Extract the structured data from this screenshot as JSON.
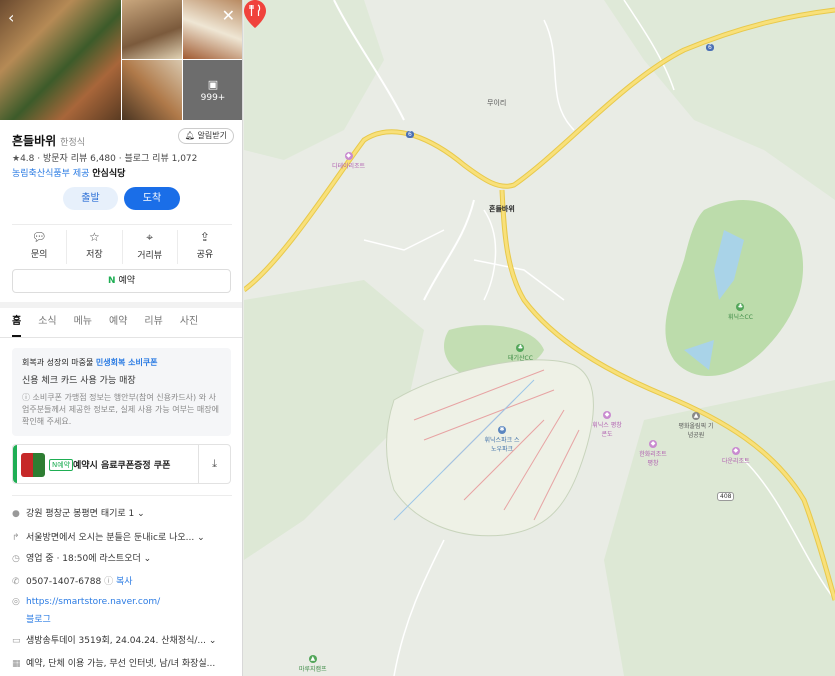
{
  "gallery": {
    "photo_count": "999+",
    "back_icon": "‹",
    "close_icon": "✕"
  },
  "place": {
    "name": "흔들바위",
    "category": "한정식",
    "alarm": "알림받기",
    "rating": "4.8",
    "visitor_reviews": "방문자 리뷰 6,480",
    "blog_reviews": "블로그 리뷰 1,072",
    "gov_prefix": "농림축산식품부 제공",
    "gov_badge": "안심식당"
  },
  "buttons": {
    "start": "출발",
    "arrive": "도착"
  },
  "actions": [
    {
      "label": "문의",
      "icon": "chat-icon"
    },
    {
      "label": "저장",
      "icon": "star-icon"
    },
    {
      "label": "거리뷰",
      "icon": "location-icon"
    },
    {
      "label": "공유",
      "icon": "share-icon"
    }
  ],
  "reserve": {
    "label": "예약",
    "icon": "N"
  },
  "tabs": [
    "홈",
    "소식",
    "메뉴",
    "예약",
    "리뷰",
    "사진"
  ],
  "coupon_info": {
    "title_prefix": "회복과 성장의 마중물",
    "title_highlight": "민생회복 소비쿠폰",
    "subtitle": "신용 체크 카드 사용 가능 매장",
    "note": "ⓘ 소비쿠폰 가맹점 정보는 행안부(참여 신용카드사) 와 사업주분들께서 제공한 정보로, 실제 사용 가능 여부는 매장에 확인해 주세요."
  },
  "coupon": {
    "badge": "N예약",
    "text": "예약시 음료쿠폰증정 쿠폰"
  },
  "info": {
    "address": "강원 평창군 봉평면 태기로 1",
    "directions": "서울방면에서 오시는 분들은 둔내ic로 나오...",
    "hours_status": "영업 중",
    "hours_detail": "18:50에 라스트오더",
    "phone": "0507-1407-6788",
    "copy": "복사",
    "website": "https://smartstore.naver.com/",
    "blog": "블로그",
    "tv": "생방송투데이 3519회, 24.04.24. 산채정식/...",
    "amenities": "예약, 단체 이용 가능, 무선 인터넷, 남/녀 화장실..."
  },
  "map": {
    "marker_label": "흔들바위",
    "village": "무이리",
    "pois": {
      "resort1": "디테이리조트",
      "taegi_cc": "태기산CC",
      "phoenix_cc": "휘닉스CC",
      "phoenix_snow": "휘닉스파크 스노우파크",
      "phoenix_park": "휘닉스 평창콘도",
      "hanwha": "한화리조트 평창",
      "memorial": "평화올림픽 기념공원",
      "daum": "다운리조트",
      "camp": "마루지캠프"
    },
    "roads": [
      "6",
      "6",
      "408"
    ],
    "colors": {
      "land": "#e9ece5",
      "forest": "#d4e5cc",
      "golf": "#b9d9a8",
      "road_main": "#f6da6b",
      "road_minor": "#ffffff",
      "water": "#9ec9e8"
    }
  }
}
